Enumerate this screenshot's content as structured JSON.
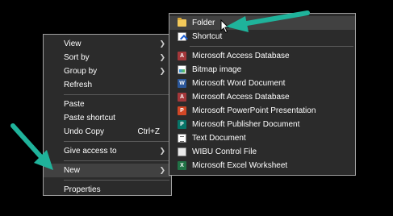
{
  "main_menu": {
    "items": [
      {
        "label": "View",
        "has_submenu": true
      },
      {
        "label": "Sort by",
        "has_submenu": true
      },
      {
        "label": "Group by",
        "has_submenu": true
      },
      {
        "label": "Refresh"
      },
      {
        "label": "Paste"
      },
      {
        "label": "Paste shortcut"
      },
      {
        "label": "Undo Copy",
        "shortcut": "Ctrl+Z"
      },
      {
        "label": "Give access to",
        "has_submenu": true
      },
      {
        "label": "New",
        "has_submenu": true
      },
      {
        "label": "Properties"
      }
    ]
  },
  "sub_menu": {
    "items": [
      {
        "label": "Folder",
        "icon": "folder-icon"
      },
      {
        "label": "Shortcut",
        "icon": "shortcut-icon"
      },
      {
        "label": "Microsoft Access Database",
        "icon": "access-icon"
      },
      {
        "label": "Bitmap image",
        "icon": "bitmap-icon"
      },
      {
        "label": "Microsoft Word Document",
        "icon": "word-icon"
      },
      {
        "label": "Microsoft Access Database",
        "icon": "access-icon"
      },
      {
        "label": "Microsoft PowerPoint Presentation",
        "icon": "powerpoint-icon"
      },
      {
        "label": "Microsoft Publisher Document",
        "icon": "publisher-icon"
      },
      {
        "label": "Text Document",
        "icon": "text-document-icon"
      },
      {
        "label": "WIBU Control File",
        "icon": "wibu-icon"
      },
      {
        "label": "Microsoft Excel Worksheet",
        "icon": "excel-icon"
      }
    ]
  },
  "colors": {
    "menu_bg": "#2b2b2b",
    "hover_bg": "#414141",
    "border": "#a0a0a0",
    "annotation_arrow": "#1fb39b"
  }
}
